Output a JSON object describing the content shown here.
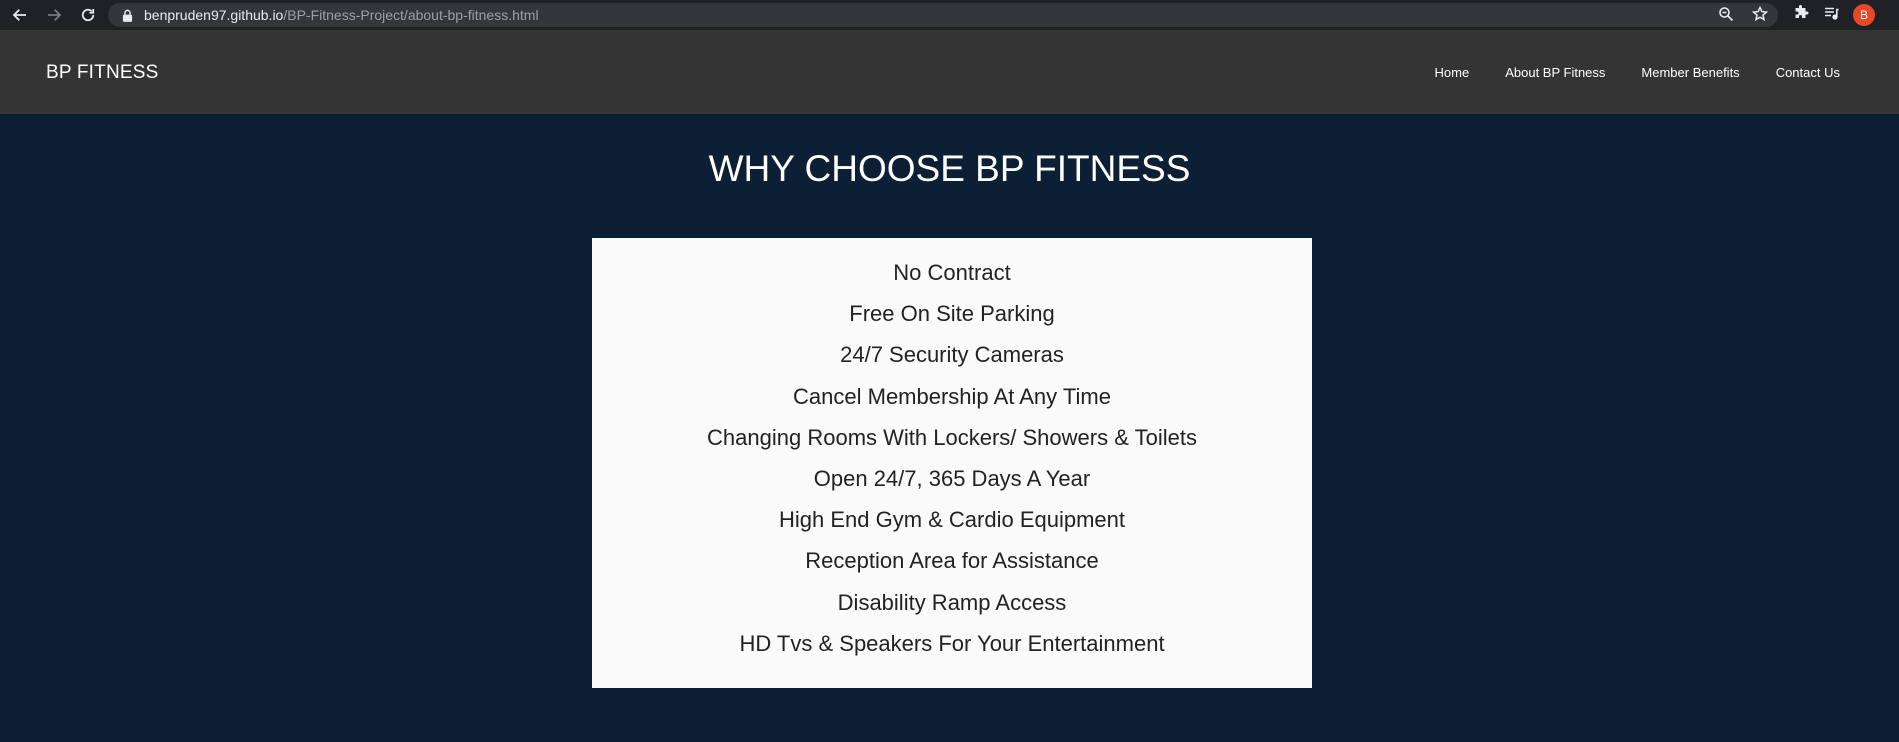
{
  "browser": {
    "url_host": "benpruden97.github.io",
    "url_path": "/BP-Fitness-Project/about-bp-fitness.html",
    "profile_initial": "B",
    "accent_color": "#e8472a"
  },
  "header": {
    "brand": "BP FITNESS",
    "nav": [
      {
        "label": "Home"
      },
      {
        "label": "About BP Fitness"
      },
      {
        "label": "Member Benefits"
      },
      {
        "label": "Contact Us"
      }
    ],
    "background": "#343434"
  },
  "main": {
    "title": "WHY CHOOSE BP FITNESS",
    "background": "#0d1f35",
    "benefits": [
      "No Contract",
      "Free On Site Parking",
      "24/7 Security Cameras",
      "Cancel Membership At Any Time",
      "Changing Rooms With Lockers/ Showers & Toilets",
      "Open 24/7, 365 Days A Year",
      "High End Gym & Cardio Equipment",
      "Reception Area for Assistance",
      "Disability Ramp Access",
      "HD Tvs & Speakers For Your Entertainment"
    ]
  },
  "icons": {
    "back": "back-arrow-icon",
    "forward": "forward-arrow-icon",
    "reload": "reload-icon",
    "lock": "lock-icon",
    "zoom": "zoom-icon",
    "bookmark": "star-icon",
    "extensions": "puzzle-icon",
    "media": "media-queue-icon",
    "menu": "kebab-menu-icon"
  }
}
